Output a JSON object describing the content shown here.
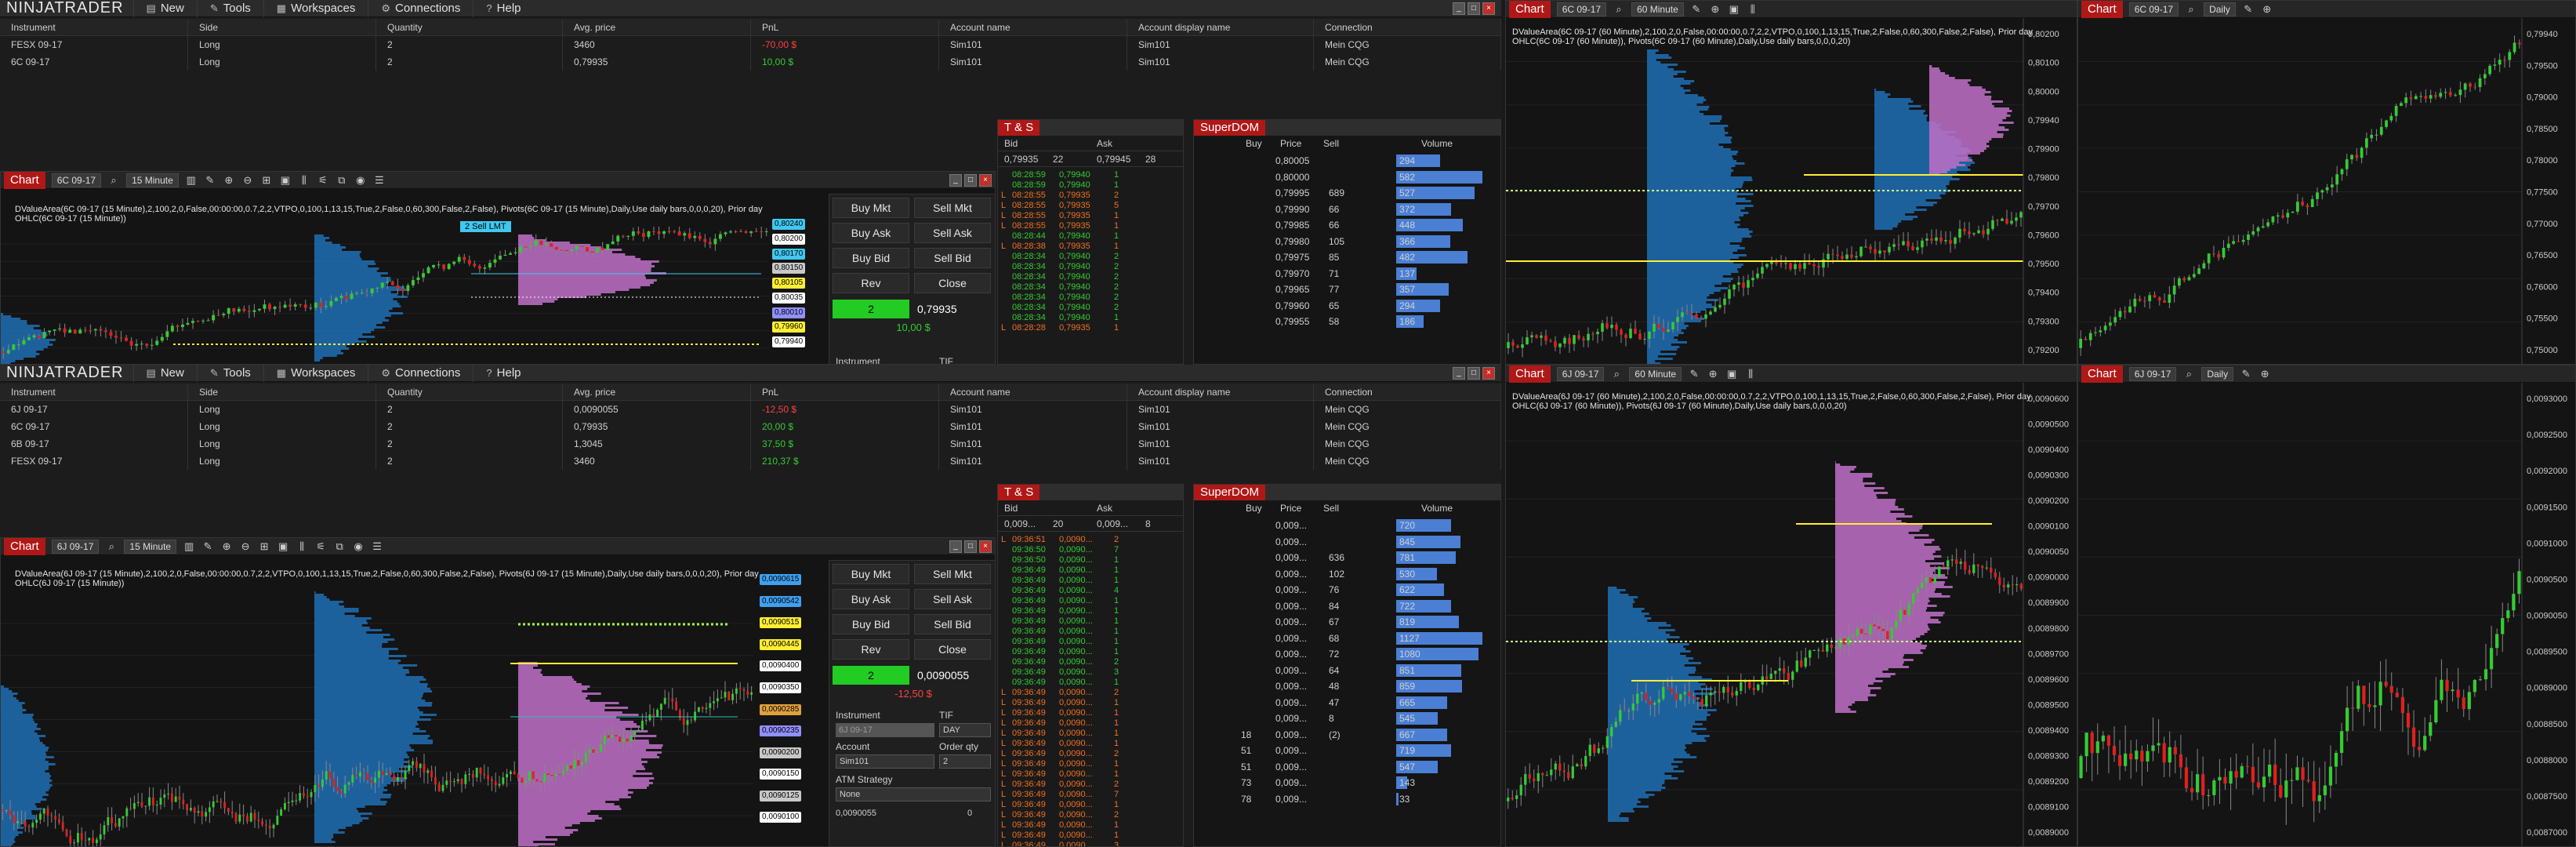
{
  "app": {
    "logo_a": "NINJA",
    "logo_b": "TRADER"
  },
  "menu": [
    "New",
    "Tools",
    "Workspaces",
    "Connections",
    "Help"
  ],
  "positions_top": {
    "headers": [
      "Instrument",
      "Side",
      "Quantity",
      "Avg. price",
      "PnL",
      "Account name",
      "Account display name",
      "Connection"
    ],
    "rows": [
      [
        "FESX 09-17",
        "Long",
        "2",
        "3460",
        "-70,00 $",
        "Sim101",
        "Sim101",
        "Mein CQG"
      ],
      [
        "6C 09-17",
        "Long",
        "2",
        "0,79935",
        "10,00 $",
        "Sim101",
        "Sim101",
        "Mein CQG"
      ]
    ]
  },
  "positions_bot": {
    "headers": [
      "Instrument",
      "Side",
      "Quantity",
      "Avg. price",
      "PnL",
      "Account name",
      "Account display name",
      "Connection"
    ],
    "rows": [
      [
        "6J 09-17",
        "Long",
        "2",
        "0,0090055",
        "-12,50 $",
        "Sim101",
        "Sim101",
        "Mein CQG"
      ],
      [
        "6C 09-17",
        "Long",
        "2",
        "0,79935",
        "20,00 $",
        "Sim101",
        "Sim101",
        "Mein CQG"
      ],
      [
        "6B 09-17",
        "Long",
        "2",
        "1,3045",
        "37,50 $",
        "Sim101",
        "Sim101",
        "Mein CQG"
      ],
      [
        "FESX 09-17",
        "Long",
        "2",
        "3460",
        "210,37 $",
        "Sim101",
        "Sim101",
        "Mein CQG"
      ]
    ]
  },
  "chart_top": {
    "title": "Chart",
    "instrument": "6C 09-17",
    "interval": "15 Minute",
    "ind1": "DValueArea(6C 09-17 (15 Minute),2,100,2,0,False,00:00:00,0.7,2,2,VTPO,0,100,1,13,15,True,2,False,0,60,300,False,2,False), Pivots(6C 09-17 (15 Minute),Daily,Use daily bars,0,0,0,20), Prior day",
    "ind2": "OHLC(6C 09-17 (15 Minute))",
    "sell_lmt": "2  Sell LMT",
    "tags": [
      "0,80240",
      "0,80200",
      "0,80170",
      "0,80150",
      "0,80105",
      "0,80035",
      "0,80010",
      "0,79960",
      "0,79940"
    ]
  },
  "chart_bot": {
    "title": "Chart",
    "instrument": "6J 09-17",
    "interval": "15 Minute",
    "ind1": "DValueArea(6J 09-17 (15 Minute),2,100,2,0,False,00:00:00,0.7,2,2,VTPO,0,100,1,13,15,True,2,False,0,60,300,False,2,False), Pivots(6J 09-17 (15 Minute),Daily,Use daily bars,0,0,0,20), Prior day",
    "ind2": "OHLC(6J 09-17 (15 Minute))",
    "tags": [
      "0,0090615",
      "0,0090542",
      "0,0090515",
      "0,0090445",
      "0,0090400",
      "0,0090350",
      "0,0090285",
      "0,0090235",
      "0,0090200",
      "0,0090150",
      "0,0090125",
      "0,0090100"
    ]
  },
  "order_top": {
    "buy_mkt": "Buy Mkt",
    "sell_mkt": "Sell Mkt",
    "buy_ask": "Buy Ask",
    "sell_ask": "Sell Ask",
    "buy_bid": "Buy Bid",
    "sell_bid": "Sell Bid",
    "rev": "Rev",
    "close": "Close",
    "qty": "2",
    "price": "0,79935",
    "pnl": "10,00 $",
    "instrument_label": "Instrument",
    "tif_label": "TIF"
  },
  "order_bot": {
    "buy_mkt": "Buy Mkt",
    "sell_mkt": "Sell Mkt",
    "buy_ask": "Buy Ask",
    "sell_ask": "Sell Ask",
    "buy_bid": "Buy Bid",
    "sell_bid": "Sell Bid",
    "rev": "Rev",
    "close": "Close",
    "qty": "2",
    "price": "0,0090055",
    "pnl": "-12,50 $",
    "instrument_label": "Instrument",
    "tif_label": "TIF",
    "instrument_val": "6J 09-17",
    "tif_val": "DAY",
    "account_label": "Account",
    "order_qty_label": "Order qty",
    "account_val": "Sim101",
    "order_qty_val": "2",
    "atm_label": "ATM Strategy",
    "atm_val": "None",
    "bottom_price": "0,0090055",
    "bottom_qty": "0"
  },
  "ts_top": {
    "title": "T & S",
    "bid": "Bid",
    "ask": "Ask",
    "bid_px": "0,79935",
    "bid_sz": "22",
    "ask_px": "0,79945",
    "ask_sz": "28",
    "rows": [
      [
        "",
        "08:28:59",
        "0,79940",
        "1",
        "g"
      ],
      [
        "",
        "08:28:59",
        "0,79940",
        "1",
        "g"
      ],
      [
        "L",
        "08:28:55",
        "0,79935",
        "2",
        "r"
      ],
      [
        "L",
        "08:28:55",
        "0,79935",
        "5",
        "r"
      ],
      [
        "L",
        "08:28:55",
        "0,79935",
        "1",
        "r"
      ],
      [
        "L",
        "08:28:55",
        "0,79935",
        "1",
        "r"
      ],
      [
        "",
        "08:28:44",
        "0,79940",
        "1",
        "g"
      ],
      [
        "L",
        "08:28:38",
        "0,79935",
        "1",
        "r"
      ],
      [
        "",
        "08:28:34",
        "0,79940",
        "2",
        "g"
      ],
      [
        "",
        "08:28:34",
        "0,79940",
        "2",
        "g"
      ],
      [
        "",
        "08:28:34",
        "0,79940",
        "2",
        "g"
      ],
      [
        "",
        "08:28:34",
        "0,79940",
        "2",
        "g"
      ],
      [
        "",
        "08:28:34",
        "0,79940",
        "2",
        "g"
      ],
      [
        "",
        "08:28:34",
        "0,79940",
        "2",
        "g"
      ],
      [
        "",
        "08:28:34",
        "0,79940",
        "1",
        "g"
      ],
      [
        "L",
        "08:28:28",
        "0,79935",
        "1",
        "r"
      ]
    ]
  },
  "ts_bot": {
    "title": "T & S",
    "bid": "Bid",
    "ask": "Ask",
    "bid_px": "0,009...",
    "bid_sz": "20",
    "ask_px": "0,009...",
    "ask_sz": "8",
    "rows": [
      [
        "L",
        "09:36:51",
        "0,0090...",
        "2",
        "r"
      ],
      [
        "",
        "09:36:50",
        "0,0090...",
        "7",
        "g"
      ],
      [
        "",
        "09:36:50",
        "0,0090...",
        "1",
        "g"
      ],
      [
        "",
        "09:36:49",
        "0,0090...",
        "1",
        "g"
      ],
      [
        "",
        "09:36:49",
        "0,0090...",
        "1",
        "g"
      ],
      [
        "",
        "09:36:49",
        "0,0090...",
        "4",
        "g"
      ],
      [
        "",
        "09:36:49",
        "0,0090...",
        "1",
        "g"
      ],
      [
        "",
        "09:36:49",
        "0,0090...",
        "1",
        "g"
      ],
      [
        "",
        "09:36:49",
        "0,0090...",
        "1",
        "g"
      ],
      [
        "",
        "09:36:49",
        "0,0090...",
        "1",
        "g"
      ],
      [
        "",
        "09:36:49",
        "0,0090...",
        "1",
        "g"
      ],
      [
        "",
        "09:36:49",
        "0,0090...",
        "1",
        "g"
      ],
      [
        "",
        "09:36:49",
        "0,0090...",
        "2",
        "g"
      ],
      [
        "",
        "09:36:49",
        "0,0090...",
        "3",
        "g"
      ],
      [
        "",
        "09:36:49",
        "0,0090...",
        "1",
        "g"
      ],
      [
        "L",
        "09:36:49",
        "0,0090...",
        "2",
        "r"
      ],
      [
        "L",
        "09:36:49",
        "0,0090...",
        "1",
        "r"
      ],
      [
        "L",
        "09:36:49",
        "0,0090...",
        "1",
        "r"
      ],
      [
        "L",
        "09:36:49",
        "0,0090...",
        "1",
        "r"
      ],
      [
        "L",
        "09:36:49",
        "0,0090...",
        "1",
        "r"
      ],
      [
        "L",
        "09:36:49",
        "0,0090...",
        "1",
        "r"
      ],
      [
        "L",
        "09:36:49",
        "0,0090...",
        "2",
        "r"
      ],
      [
        "L",
        "09:36:49",
        "0,0090...",
        "1",
        "r"
      ],
      [
        "L",
        "09:36:49",
        "0,0090...",
        "1",
        "r"
      ],
      [
        "L",
        "09:36:49",
        "0,0090...",
        "2",
        "r"
      ],
      [
        "L",
        "09:36:49",
        "0,0090...",
        "7",
        "r"
      ],
      [
        "L",
        "09:36:49",
        "0,0090...",
        "1",
        "r"
      ],
      [
        "L",
        "09:36:49",
        "0,0090...",
        "2",
        "r"
      ],
      [
        "L",
        "09:36:49",
        "0,0090...",
        "1",
        "r"
      ],
      [
        "L",
        "09:36:49",
        "0,0090...",
        "1",
        "r"
      ],
      [
        "L",
        "09:36:49",
        "0,0090...",
        "3",
        "r"
      ]
    ]
  },
  "sd_top": {
    "title": "SuperDOM",
    "headers": [
      "Buy",
      "Price",
      "Sell",
      "Volume"
    ],
    "rows": [
      [
        "",
        "0,80005",
        "",
        "294"
      ],
      [
        "",
        "0,80000",
        "",
        "582"
      ],
      [
        "",
        "0,79995",
        "689",
        "527"
      ],
      [
        "",
        "0,79990",
        "66",
        "372"
      ],
      [
        "",
        "0,79985",
        "66",
        "448"
      ],
      [
        "",
        "0,79980",
        "105",
        "366"
      ],
      [
        "",
        "0,79975",
        "85",
        "482"
      ],
      [
        "",
        "0,79970",
        "71",
        "137"
      ],
      [
        "",
        "0,79965",
        "77",
        "357"
      ],
      [
        "",
        "0,79960",
        "65",
        "294"
      ],
      [
        "",
        "0,79955",
        "58",
        "186"
      ]
    ]
  },
  "sd_bot": {
    "title": "SuperDOM",
    "headers": [
      "Buy",
      "Price",
      "Sell",
      "Volume"
    ],
    "rows": [
      [
        "",
        "0,009...",
        "",
        "720"
      ],
      [
        "",
        "0,009...",
        "",
        "845"
      ],
      [
        "",
        "0,009...",
        "636",
        "781"
      ],
      [
        "",
        "0,009...",
        "102",
        "530"
      ],
      [
        "",
        "0,009...",
        "76",
        "622"
      ],
      [
        "",
        "0,009...",
        "84",
        "722"
      ],
      [
        "",
        "0,009...",
        "67",
        "819"
      ],
      [
        "",
        "0,009...",
        "68",
        "1127"
      ],
      [
        "",
        "0,009...",
        "72",
        "1080"
      ],
      [
        "",
        "0,009...",
        "64",
        "851"
      ],
      [
        "",
        "0,009...",
        "48",
        "859"
      ],
      [
        "",
        "0,009...",
        "47",
        "665"
      ],
      [
        "",
        "0,009...",
        "8",
        "545"
      ],
      [
        "18",
        "0,009...",
        "(2)",
        "667"
      ],
      [
        "51",
        "0,009...",
        "",
        "719"
      ],
      [
        "51",
        "0,009...",
        "",
        "547"
      ],
      [
        "73",
        "0,009...",
        "",
        "143"
      ],
      [
        "78",
        "0,009...",
        "",
        "33"
      ]
    ]
  },
  "right_top_chart": {
    "title": "Chart",
    "instrument": "6C 09-17",
    "interval": "60 Minute",
    "ind1": "DValueArea(6C 09-17 (60 Minute),2,100,2,0,False,00:00:00,0.7,2,2,VTPO,0,100,1,13,15,True,2,False,0,60,300,False,2,False), Prior day",
    "ind2": "OHLC(6C 09-17 (60 Minute)), Pivots(6C 09-17 (60 Minute),Daily,Use daily bars,0,0,0,20)",
    "yticks": [
      "0,80200",
      "0,80100",
      "0,80000",
      "0,79940",
      "0,79900",
      "0,79800",
      "0,79700",
      "0,79600",
      "0,79500",
      "0,79400",
      "0,79300",
      "0,79200"
    ]
  },
  "right_top_daily": {
    "title": "Chart",
    "instrument": "6C 09-17",
    "interval": "Daily",
    "yticks": [
      "0,79940",
      "0,79500",
      "0,79000",
      "0,78500",
      "0,78000",
      "0,77500",
      "0,77000",
      "0,76500",
      "0,76000",
      "0,75500",
      "0,75000"
    ]
  },
  "right_bot_chart": {
    "title": "Chart",
    "instrument": "6J 09-17",
    "interval": "60 Minute",
    "ind1": "DValueArea(6J 09-17 (60 Minute),2,100,2,0,False,00:00:00,0.7,2,2,VTPO,0,100,1,13,15,True,2,False,0,60,300,False,2,False), Prior day",
    "ind2": "OHLC(6J 09-17 (60 Minute)), Pivots(6J 09-17 (60 Minute),Daily,Use daily bars,0,0,0,20)",
    "yticks": [
      "0,0090600",
      "0,0090500",
      "0,0090400",
      "0,0090300",
      "0,0090200",
      "0,0090100",
      "0,0090050",
      "0,0090000",
      "0,0089900",
      "0,0089800",
      "0,0089700",
      "0,0089600",
      "0,0089500",
      "0,0089400",
      "0,0089300",
      "0,0089200",
      "0,0089100",
      "0,0089000"
    ]
  },
  "right_bot_daily": {
    "title": "Chart",
    "instrument": "6J 09-17",
    "interval": "Daily",
    "yticks": [
      "0,0093000",
      "0,0092500",
      "0,0092000",
      "0,0091500",
      "0,0091000",
      "0,0090500",
      "0,0090050",
      "0,0089500",
      "0,0089000",
      "0,0088500",
      "0,0088000",
      "0,0087500",
      "0,0087000"
    ]
  },
  "colors": {
    "accent": "#b01818",
    "bull": "#33cc33",
    "bear": "#e02020",
    "value_area": "#c070c8",
    "profile": "#1f6fb4",
    "dom_bar": "#4a7fd4"
  }
}
